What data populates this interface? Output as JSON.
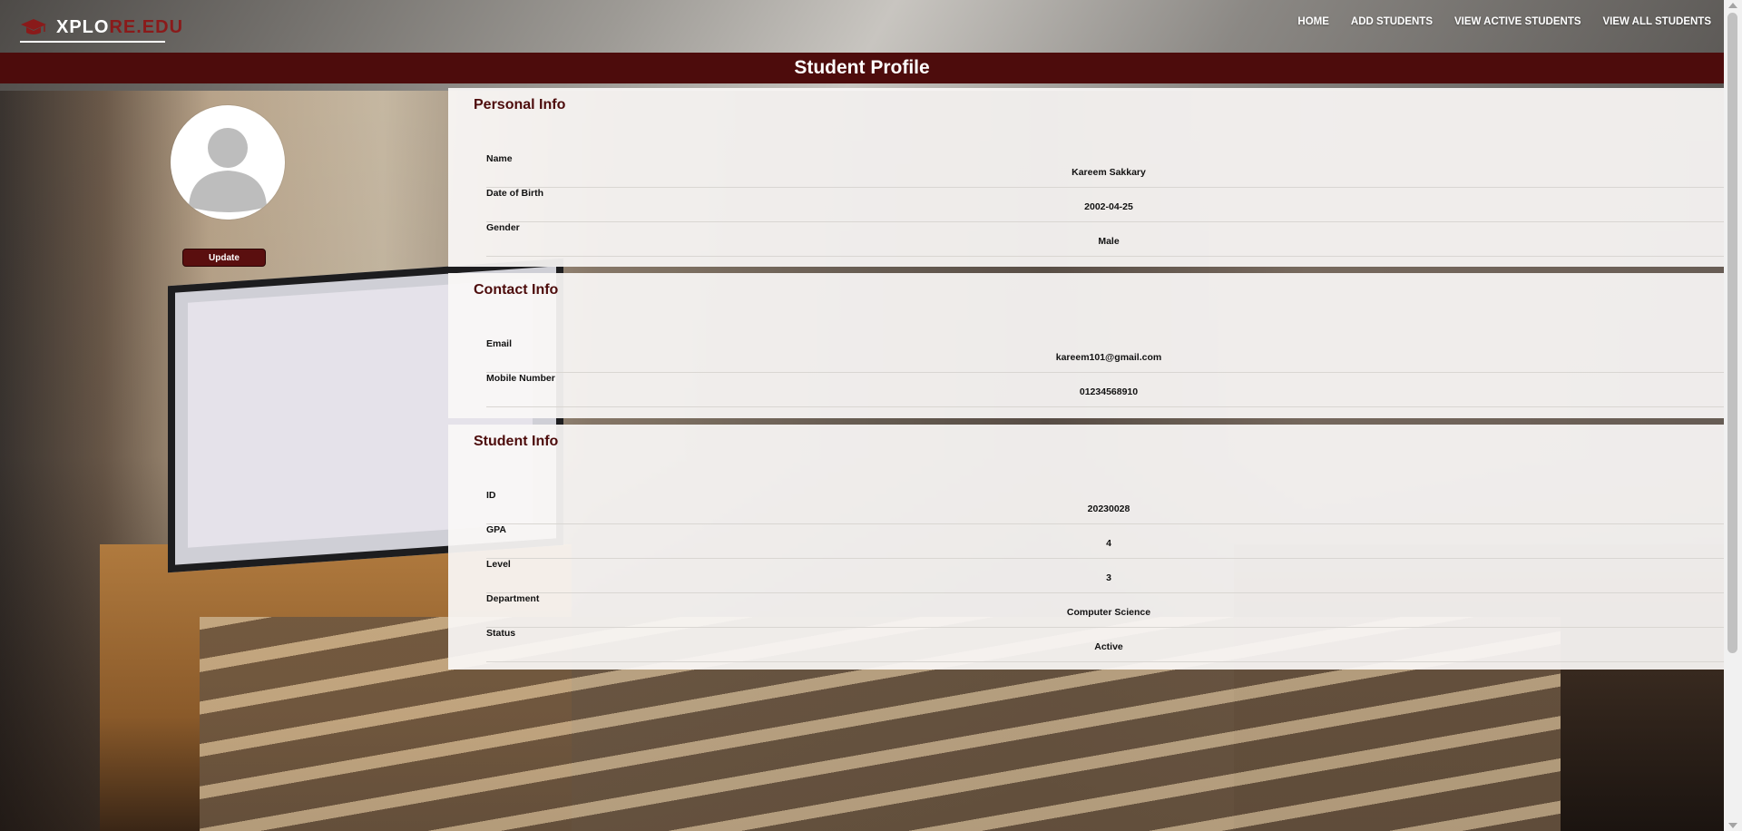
{
  "brand": {
    "name_part1": "XPLO",
    "name_part2": "RE.EDU",
    "icon": "graduation-cap-icon",
    "accent_color": "#8a1a1a"
  },
  "nav": {
    "items": [
      {
        "label": "HOME"
      },
      {
        "label": "ADD STUDENTS"
      },
      {
        "label": "VIEW ACTIVE STUDENTS"
      },
      {
        "label": "VIEW ALL STUDENTS"
      }
    ]
  },
  "header": {
    "title": "Student Profile",
    "band_color": "#4d0c0c"
  },
  "profile": {
    "avatar_icon": "user-avatar-icon",
    "update_label": "Update"
  },
  "personal": {
    "title": "Personal Info",
    "rows": [
      {
        "label": "Name",
        "value": "Kareem Sakkary"
      },
      {
        "label": "Date of Birth",
        "value": "2002-04-25"
      },
      {
        "label": "Gender",
        "value": "Male"
      }
    ]
  },
  "contact": {
    "title": "Contact Info",
    "rows": [
      {
        "label": "Email",
        "value": "kareem101@gmail.com"
      },
      {
        "label": "Mobile Number",
        "value": "01234568910"
      }
    ]
  },
  "student": {
    "title": "Student Info",
    "rows": [
      {
        "label": "ID",
        "value": "20230028"
      },
      {
        "label": "GPA",
        "value": "4"
      },
      {
        "label": "Level",
        "value": "3"
      },
      {
        "label": "Department",
        "value": "Computer Science"
      },
      {
        "label": "Status",
        "value": "Active"
      }
    ]
  }
}
